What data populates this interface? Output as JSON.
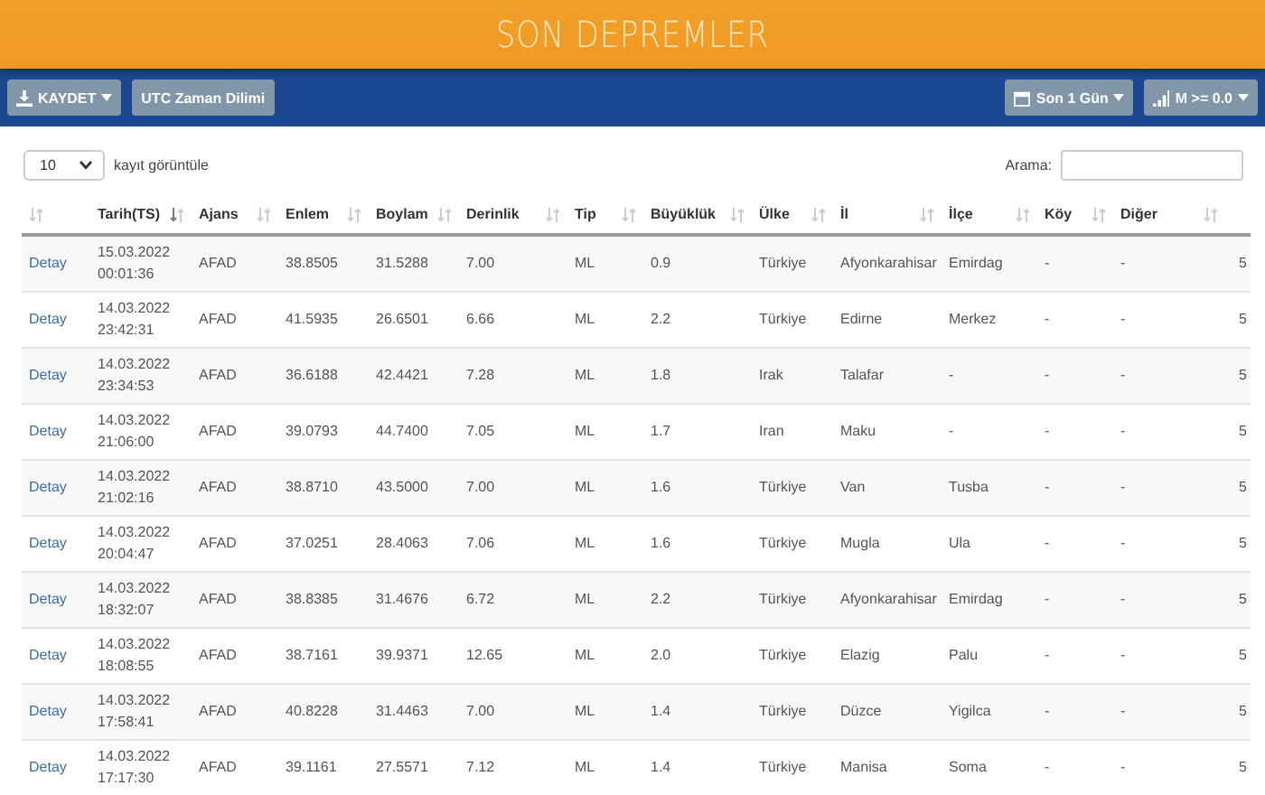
{
  "header": {
    "title": "SON DEPREMLER"
  },
  "toolbar": {
    "left_buttons": [
      {
        "label": "KAYDET",
        "dropdown": true
      },
      {
        "label": "UTC Zaman Dilimi",
        "dropdown": false
      }
    ],
    "right_buttons": [
      {
        "label": "Son 1 Gün",
        "dropdown": true
      },
      {
        "label": "M >= 0.0",
        "dropdown": true
      }
    ]
  },
  "length_control": {
    "value": "10",
    "label": "kayıt görüntüle"
  },
  "search": {
    "label": "Arama:"
  },
  "table": {
    "columns": [
      {
        "selected": false
      },
      {
        "label": "Tarih(TS)",
        "selected": true
      },
      {
        "label": "Ajans",
        "selected": false
      },
      {
        "label": "Enlem",
        "selected": false
      },
      {
        "label": "Boylam",
        "selected": false
      },
      {
        "label": "Derinlik",
        "selected": false
      },
      {
        "label": "Tip",
        "selected": false
      },
      {
        "label": "Büyüklük",
        "selected": false
      },
      {
        "label": "Ülke",
        "selected": false
      },
      {
        "label": "İl",
        "selected": false
      },
      {
        "label": "İlçe",
        "selected": false
      },
      {
        "label": "Köy",
        "selected": false
      },
      {
        "label": "Diğer",
        "selected": false
      }
    ],
    "rows": [
      {
        "cells": [
          "Detay",
          "15.03.2022 00:01:36",
          "AFAD",
          "38.8505",
          "31.5288",
          "7.00",
          "ML",
          "0.9",
          "Türkiye",
          "Afyonkarahisar",
          "Emirdag",
          "-",
          "-",
          "5"
        ]
      },
      {
        "cells": [
          "Detay",
          "14.03.2022 23:42:31",
          "AFAD",
          "41.5935",
          "26.6501",
          "6.66",
          "ML",
          "2.2",
          "Türkiye",
          "Edirne",
          "Merkez",
          "-",
          "-",
          "5"
        ]
      },
      {
        "cells": [
          "Detay",
          "14.03.2022 23:34:53",
          "AFAD",
          "36.6188",
          "42.4421",
          "7.28",
          "ML",
          "1.8",
          "Irak",
          "Talafar",
          "-",
          "-",
          "-",
          "5"
        ]
      },
      {
        "cells": [
          "Detay",
          "14.03.2022 21:06:00",
          "AFAD",
          "39.0793",
          "44.7400",
          "7.05",
          "ML",
          "1.7",
          "Iran",
          "Maku",
          "-",
          "-",
          "-",
          "5"
        ]
      },
      {
        "cells": [
          "Detay",
          "14.03.2022 21:02:16",
          "AFAD",
          "38.8710",
          "43.5000",
          "7.00",
          "ML",
          "1.6",
          "Türkiye",
          "Van",
          "Tusba",
          "-",
          "-",
          "5"
        ]
      },
      {
        "cells": [
          "Detay",
          "14.03.2022 20:04:47",
          "AFAD",
          "37.0251",
          "28.4063",
          "7.06",
          "ML",
          "1.6",
          "Türkiye",
          "Mugla",
          "Ula",
          "-",
          "-",
          "5"
        ]
      },
      {
        "cells": [
          "Detay",
          "14.03.2022 18:32:07",
          "AFAD",
          "38.8385",
          "31.4676",
          "6.72",
          "ML",
          "2.2",
          "Türkiye",
          "Afyonkarahisar",
          "Emirdag",
          "-",
          "-",
          "5"
        ]
      },
      {
        "cells": [
          "Detay",
          "14.03.2022 18:08:55",
          "AFAD",
          "38.7161",
          "39.9371",
          "12.65",
          "ML",
          "2.0",
          "Türkiye",
          "Elazig",
          "Palu",
          "-",
          "-",
          "5"
        ]
      },
      {
        "cells": [
          "Detay",
          "14.03.2022 17:58:41",
          "AFAD",
          "40.8228",
          "31.4463",
          "7.00",
          "ML",
          "1.4",
          "Türkiye",
          "Düzce",
          "Yigilca",
          "-",
          "-",
          "5"
        ]
      },
      {
        "cells": [
          "Detay",
          "14.03.2022 17:17:30",
          "AFAD",
          "39.1161",
          "27.5571",
          "7.12",
          "ML",
          "1.4",
          "Türkiye",
          "Manisa",
          "Soma",
          "-",
          "-",
          "5"
        ]
      }
    ]
  }
}
